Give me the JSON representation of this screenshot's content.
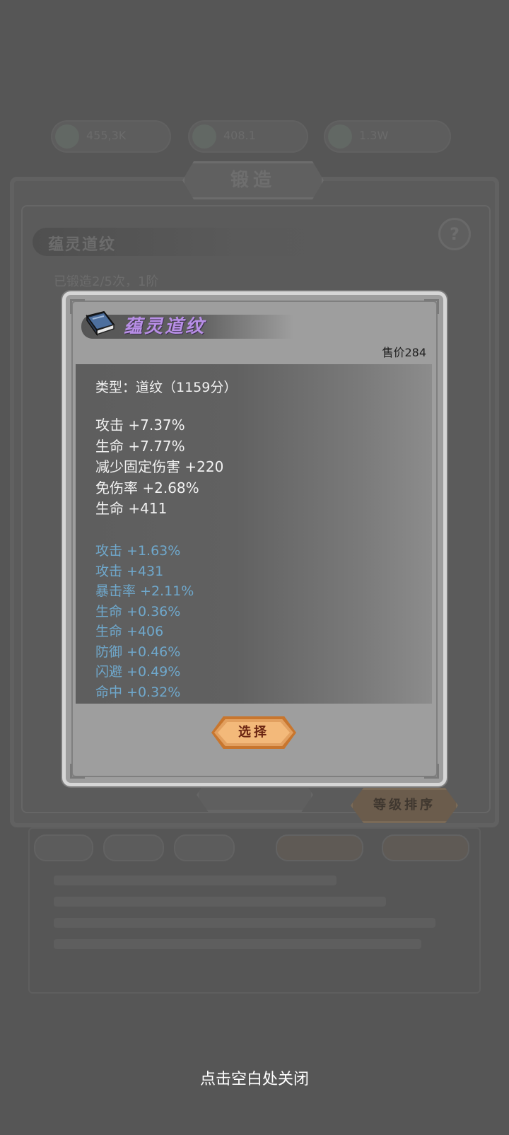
{
  "background": {
    "resources": [
      "455,3K",
      "408.1",
      "1.3W"
    ],
    "tab_title": "锻造",
    "banner_title": "蕴灵道纹",
    "help_label": "?",
    "forge_info": "已锻造2/5次，1阶",
    "sort_button": "等级排序"
  },
  "item_popup": {
    "name": "蕴灵道纹",
    "price": "售价284",
    "type_line": "类型：道纹（1159分）",
    "main_stats": [
      "攻击 +7.37%",
      "生命 +7.77%",
      "减少固定伤害 +220",
      "免伤率 +2.68%",
      "生命 +411"
    ],
    "sub_stats": [
      "攻击 +1.63%",
      "攻击 +431",
      "暴击率 +2.11%",
      "生命 +0.36%",
      "生命 +406",
      "防御 +0.46%",
      "闪避 +0.49%",
      "命中 +0.32%"
    ],
    "select_button": "选择",
    "name_color": "#b88fe6",
    "sub_stat_color": "#6fa8cc"
  },
  "close_hint": "点击空白处关闭"
}
